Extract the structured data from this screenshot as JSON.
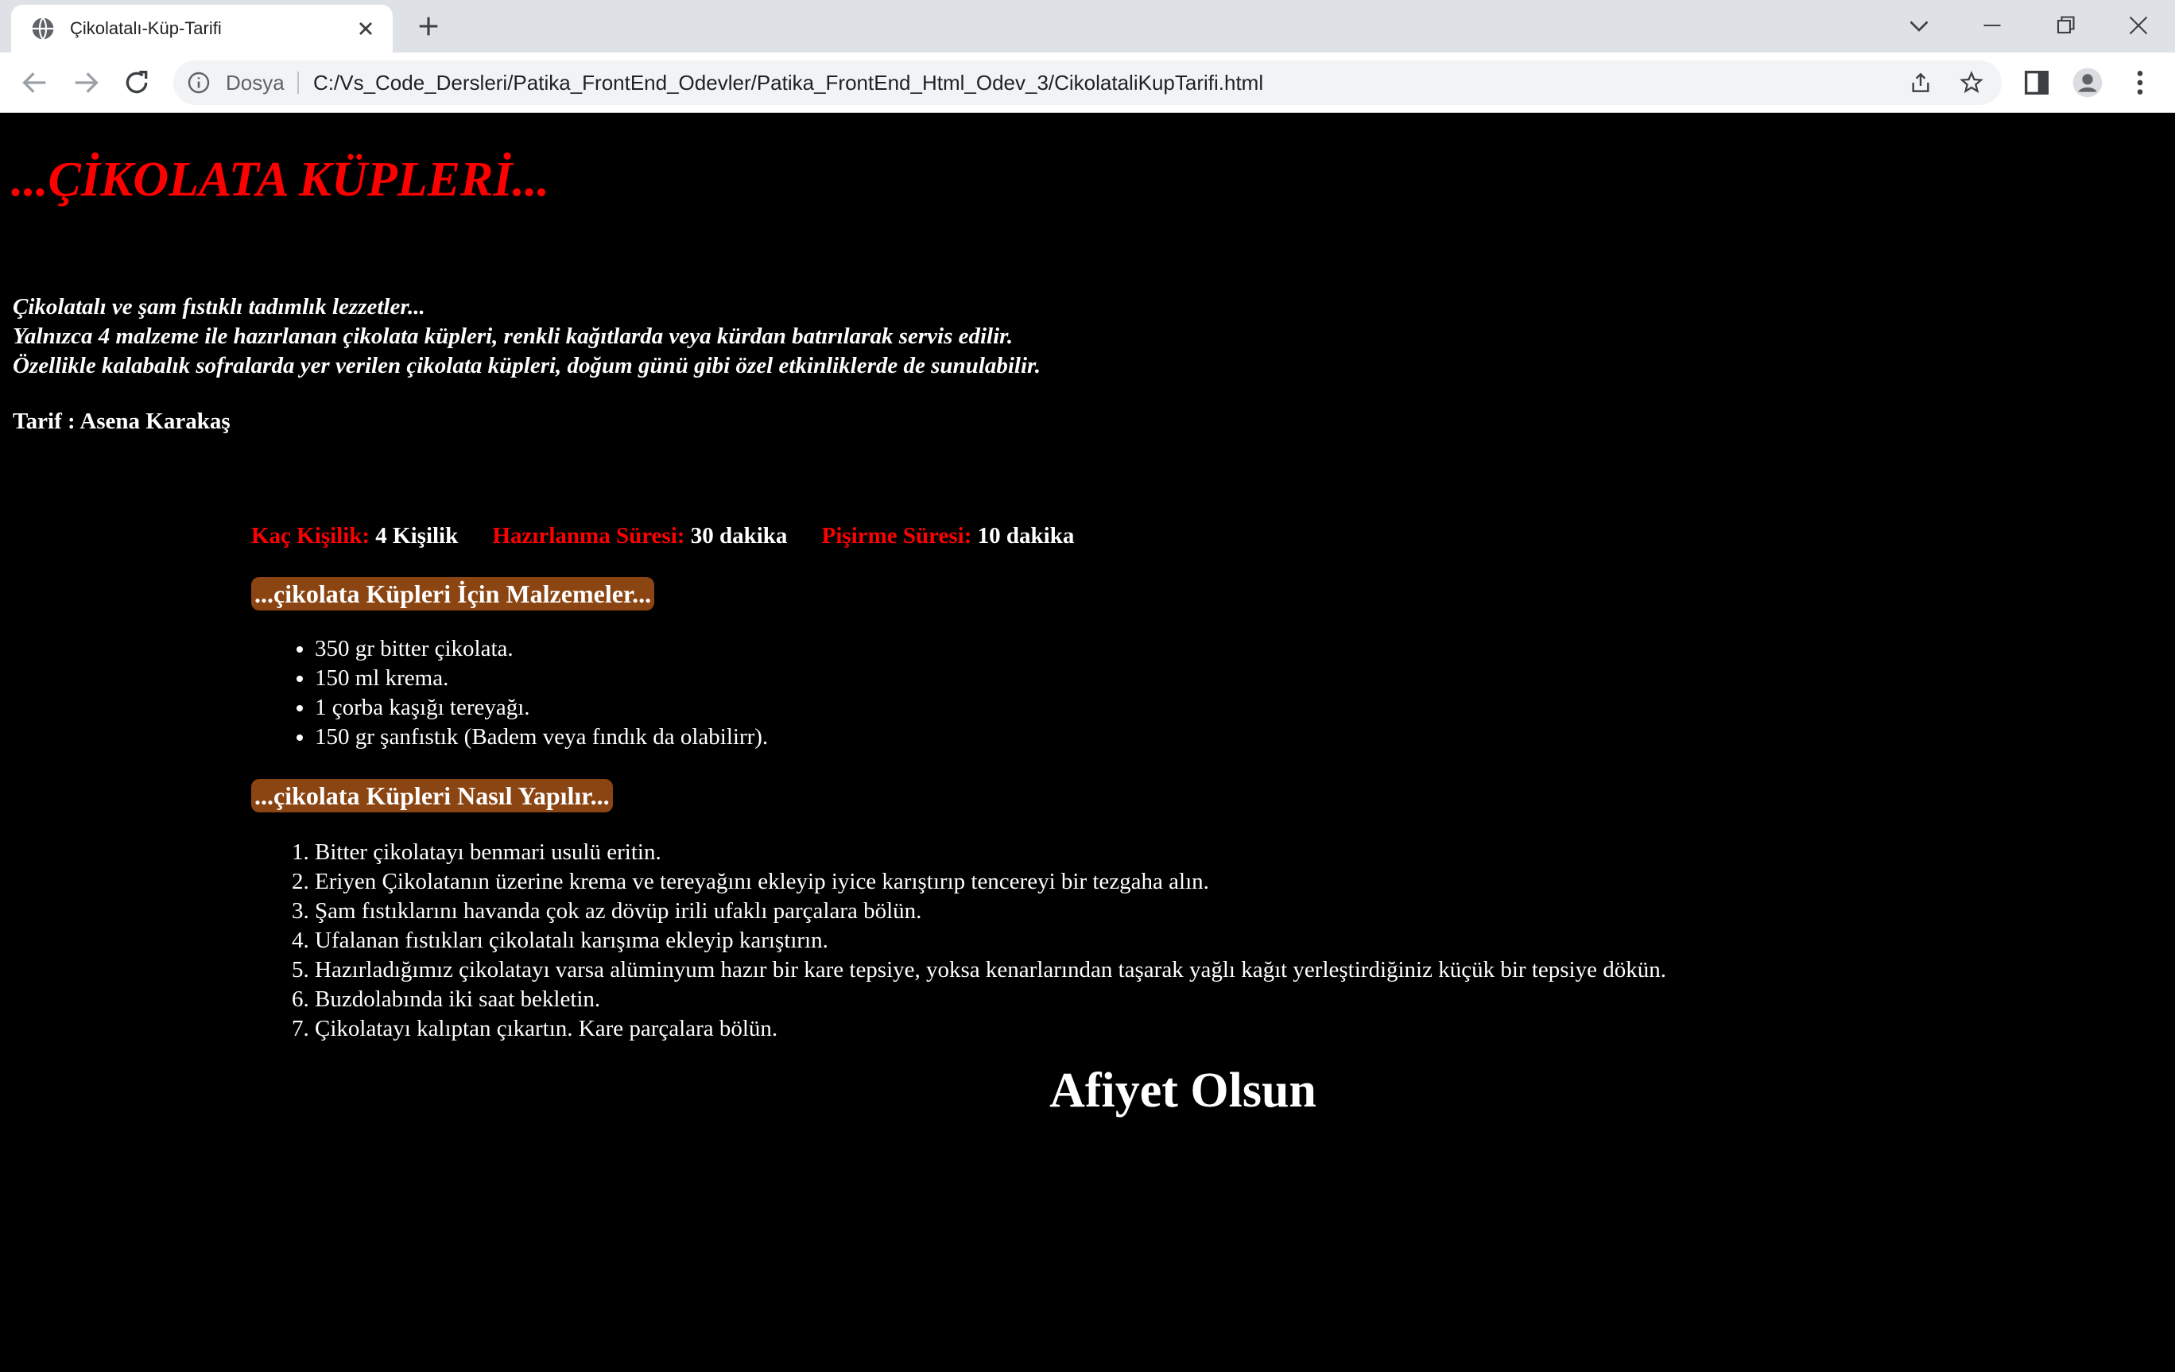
{
  "browser": {
    "tab_title": "Çikolatalı-Küp-Tarifi",
    "scheme_label": "Dosya",
    "url": "C:/Vs_Code_Dersleri/Patika_FrontEnd_Odevler/Patika_FrontEnd_Html_Odev_3/CikolataliKupTarifi.html",
    "icons": {
      "tab": "globe-icon",
      "close": "close-icon",
      "new_tab": "plus-icon",
      "back": "back-arrow-icon",
      "forward": "forward-arrow-icon",
      "reload": "reload-icon",
      "info": "info-icon",
      "share": "share-icon",
      "bookmark": "star-icon",
      "side_panel": "side-panel-icon",
      "profile": "profile-icon",
      "menu": "kebab-menu-icon"
    }
  },
  "page": {
    "title": "...ÇİKOLATA KÜPLERİ...",
    "intro": [
      "Çikolatalı ve şam fıstıklı tadımlık lezzetler...",
      "Yalnızca 4 malzeme ile hazırlanan çikolata küpleri, renkli kağıtlarda veya kürdan batırılarak servis edilir.",
      "Özellikle kalabalık sofralarda yer verilen çikolata küpleri, doğum günü gibi özel etkinliklerde de sunulabilir."
    ],
    "author": "Tarif : Asena Karakaş",
    "meta": {
      "servings_label": "Kaç Kişilik:",
      "servings_value": "4 Kişilik",
      "prep_label": "Hazırlanma Süresi:",
      "prep_value": "30 dakika",
      "cook_label": "Pişirme Süresi:",
      "cook_value": "10 dakika"
    },
    "ingredients_heading": "...çikolata Küpleri İçin Malzemeler...",
    "ingredients": [
      "350 gr bitter çikolata.",
      "150 ml krema.",
      "1 çorba kaşığı tereyağı.",
      "150 gr şanfıstık (Badem veya fındık da olabilirr)."
    ],
    "steps_heading": "...çikolata Küpleri Nasıl Yapılır...",
    "steps": [
      "Bitter çikolatayı benmari usulü eritin.",
      "Eriyen Çikolatanın üzerine krema ve tereyağını ekleyip iyice karıştırıp tencereyi bir tezgaha alın.",
      "Şam fıstıklarını havanda çok az dövüp irili ufaklı parçalara bölün.",
      "Ufalanan fıstıkları çikolatalı karışıma ekleyip karıştırın.",
      "Hazırladığımız çikolatayı varsa alüminyum hazır bir kare tepsiye, yoksa kenarlarından taşarak yağlı kağıt yerleştirdiğiniz küçük bir tepsiye dökün.",
      "Buzdolabında iki saat bekletin.",
      "Çikolatayı kalıptan çıkartın. Kare parçalara bölün."
    ],
    "closing": "Afiyet Olsun"
  },
  "colors": {
    "background": "#000000",
    "title_red": "#ff0000",
    "badge_brown": "#8b4513",
    "text": "#ffffff"
  }
}
